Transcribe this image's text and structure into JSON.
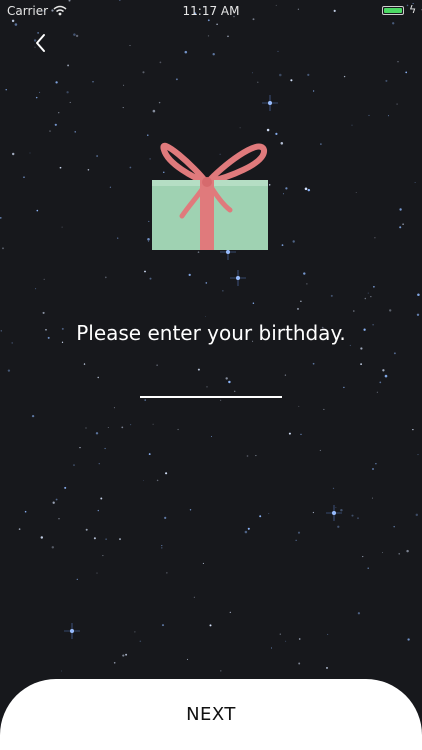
{
  "status_bar": {
    "carrier": "Carrier",
    "time": "11:17 AM"
  },
  "nav": {
    "back_icon": "chevron-left-icon"
  },
  "hero": {
    "icon": "gift-icon"
  },
  "prompt": "Please enter your birthday.",
  "birthday_input": {
    "value": "",
    "placeholder": ""
  },
  "next_button": {
    "label": "NEXT"
  },
  "colors": {
    "background": "#17181c",
    "star": "#8fb9ff",
    "gift_box": "#9fd2b2",
    "ribbon": "#e07a7c",
    "battery": "#4cd964",
    "button_bg": "#ffffff",
    "button_text": "#111111"
  }
}
